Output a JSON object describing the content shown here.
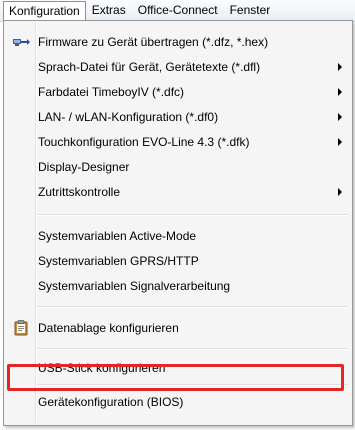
{
  "menubar": {
    "items": [
      "Konfiguration",
      "Extras",
      "Office-Connect",
      "Fenster"
    ],
    "active_index": 0
  },
  "menu": {
    "items": [
      {
        "label": "Firmware zu Gerät übertragen (*.dfz, *.hex)",
        "icon": "firmware-transfer-icon",
        "submenu": false
      },
      {
        "label": "Sprach-Datei für Gerät, Gerätetexte (*.dfl)",
        "submenu": true
      },
      {
        "label": "Farbdatei TimeboyIV (*.dfc)",
        "submenu": true
      },
      {
        "label": "LAN- / wLAN-Konfiguration (*.df0)",
        "submenu": true
      },
      {
        "label": "Touchkonfiguration EVO-Line 4.3 (*.dfk)",
        "submenu": true
      },
      {
        "label": "Display-Designer",
        "submenu": false
      },
      {
        "label": "Zutrittskontrolle",
        "submenu": true
      },
      {
        "label": "Systemvariablen Active-Mode",
        "submenu": false
      },
      {
        "label": "Systemvariablen GPRS/HTTP",
        "submenu": false
      },
      {
        "label": "Systemvariablen Signalverarbeitung",
        "submenu": false
      },
      {
        "label": "Datenablage konfigurieren",
        "icon": "clipboard-icon",
        "submenu": false
      },
      {
        "label": "USB-Stick konfigurieren",
        "submenu": false
      },
      {
        "label": "Gerätekonfiguration (BIOS)",
        "submenu": false,
        "highlighted": true
      }
    ]
  },
  "colors": {
    "highlight_border": "#e52427",
    "menu_background": "#f5f5f5"
  }
}
